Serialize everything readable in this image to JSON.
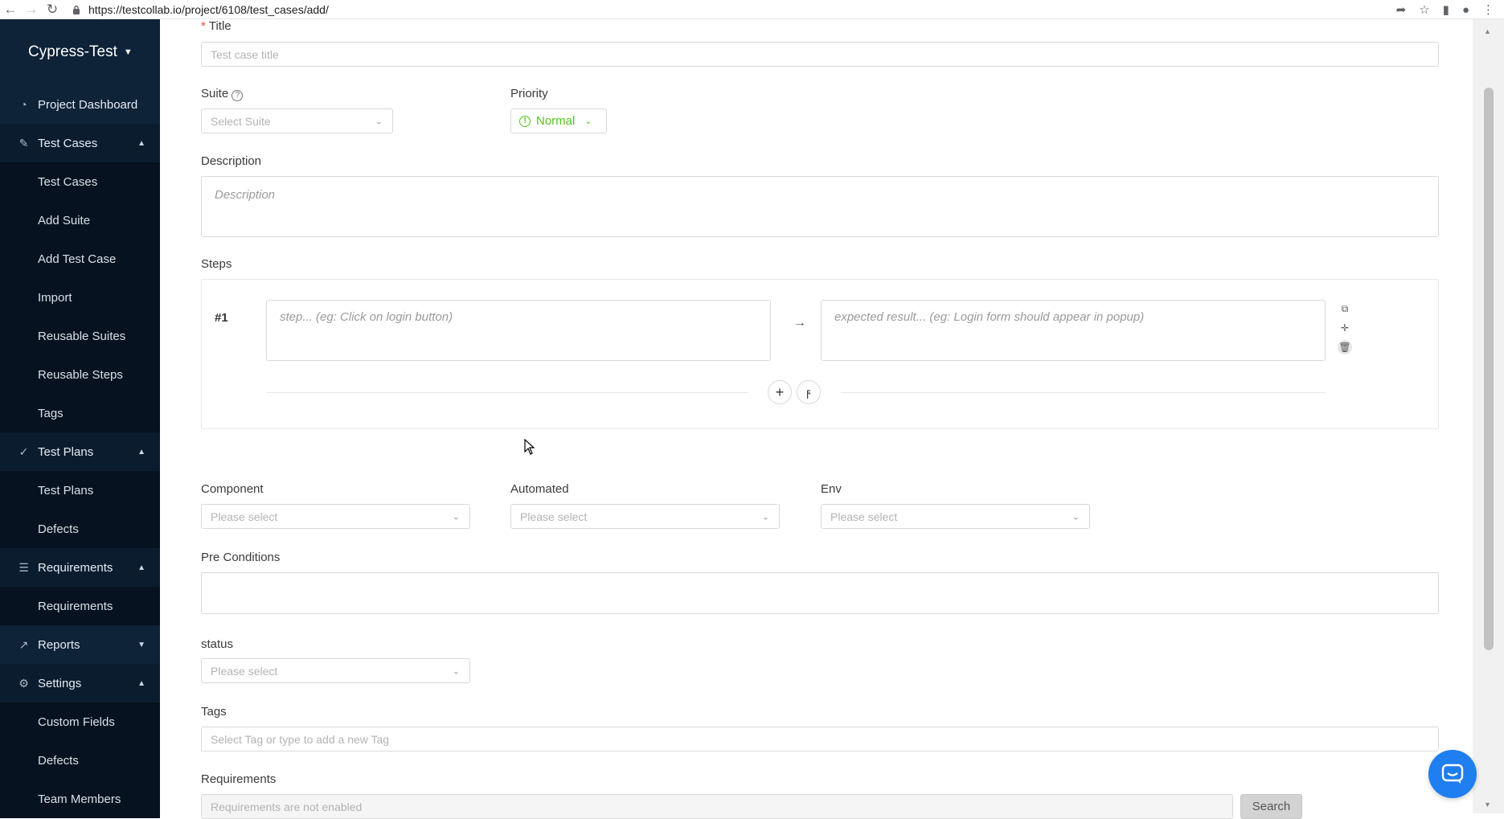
{
  "browser": {
    "url": "https://testcollab.io/project/6108/test_cases/add/"
  },
  "sidebar": {
    "project_name": "Cypress-Test",
    "items": [
      {
        "label": "Project Dashboard",
        "icon": "dashboard-icon"
      },
      {
        "label": "Test Cases",
        "icon": "edit-icon"
      },
      {
        "label": "Test Cases"
      },
      {
        "label": "Add Suite"
      },
      {
        "label": "Add Test Case"
      },
      {
        "label": "Import"
      },
      {
        "label": "Reusable Suites"
      },
      {
        "label": "Reusable Steps"
      },
      {
        "label": "Tags"
      },
      {
        "label": "Test Plans",
        "icon": "check-circle-icon"
      },
      {
        "label": "Test Plans"
      },
      {
        "label": "Defects"
      },
      {
        "label": "Requirements",
        "icon": "list-icon"
      },
      {
        "label": "Requirements"
      },
      {
        "label": "Reports",
        "icon": "chart-icon"
      },
      {
        "label": "Settings",
        "icon": "gear-icon"
      },
      {
        "label": "Custom Fields"
      },
      {
        "label": "Defects"
      },
      {
        "label": "Team Members"
      }
    ]
  },
  "form": {
    "title_label": "Title",
    "title_placeholder": "Test case title",
    "suite_label": "Suite",
    "suite_placeholder": "Select Suite",
    "priority_label": "Priority",
    "priority_value": "Normal",
    "description_label": "Description",
    "description_placeholder": "Description",
    "steps_label": "Steps",
    "step_number": "#1",
    "step_placeholder": "step... (eg: Click on login button)",
    "expected_placeholder": "expected result... (eg: Login form should appear in popup)",
    "component_label": "Component",
    "component_placeholder": "Please select",
    "automated_label": "Automated",
    "automated_placeholder": "Please select",
    "env_label": "Env",
    "env_placeholder": "Please select",
    "preconditions_label": "Pre Conditions",
    "status_label": "status",
    "status_placeholder": "Please select",
    "tags_label": "Tags",
    "tags_placeholder": "Select Tag or type to add a new Tag",
    "requirements_label": "Requirements",
    "requirements_placeholder": "Requirements are not enabled",
    "search_button": "Search"
  },
  "colors": {
    "sidebar_bg": "#0e2238",
    "sidebar_sub_bg": "#06121f",
    "priority_green": "#52c41a",
    "chat_blue": "#1f7ef0"
  }
}
